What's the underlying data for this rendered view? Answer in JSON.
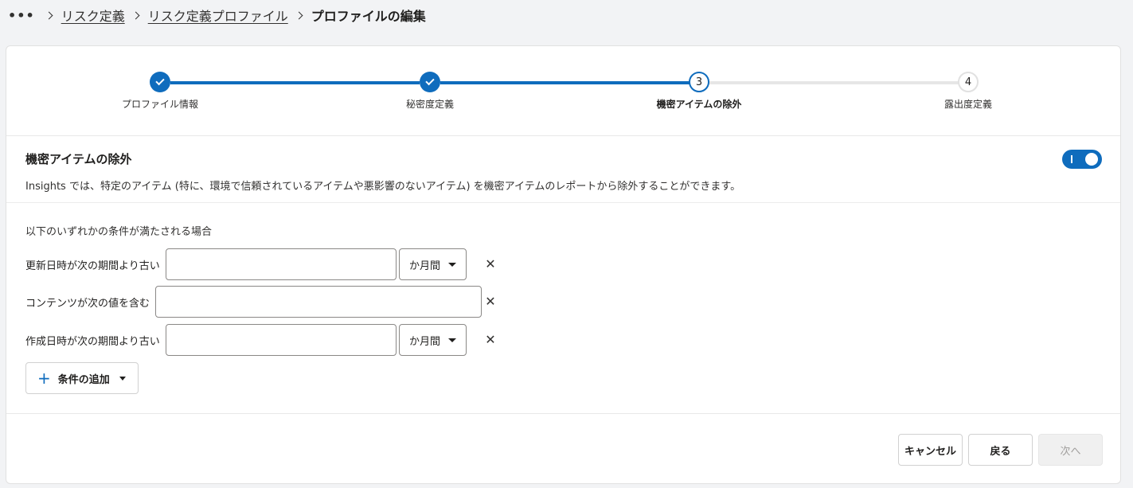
{
  "breadcrumb": {
    "more": "•••",
    "items": [
      "リスク定義",
      "リスク定義プロファイル"
    ],
    "current": "プロファイルの編集"
  },
  "stepper": {
    "steps": [
      {
        "label": "プロファイル情報",
        "state": "done",
        "number": "1"
      },
      {
        "label": "秘密度定義",
        "state": "done",
        "number": "2"
      },
      {
        "label": "機密アイテムの除外",
        "state": "current",
        "number": "3"
      },
      {
        "label": "露出度定義",
        "state": "todo",
        "number": "4"
      }
    ]
  },
  "section": {
    "title": "機密アイテムの除外",
    "description": "Insights では、特定のアイテム (特に、環境で信頼されているアイテムや悪影響のないアイテム) を機密アイテムのレポートから除外することができます。",
    "toggle_on": true,
    "toggle_glyph": "I"
  },
  "conditions": {
    "intro": "以下のいずれかの条件が満たされる場合",
    "rows": [
      {
        "label": "更新日時が次の期間より古い",
        "value": "",
        "unit": "か月間",
        "has_unit": true
      },
      {
        "label": "コンテンツが次の値を含む",
        "value": "",
        "has_unit": false
      },
      {
        "label": "作成日時が次の期間より古い",
        "value": "",
        "unit": "か月間",
        "has_unit": true
      }
    ],
    "remove_glyph": "✕",
    "add_label": "条件の追加",
    "add_icon": "+"
  },
  "footer": {
    "cancel": "キャンセル",
    "back": "戻る",
    "next": "次へ"
  },
  "colors": {
    "accent": "#0f6cbd",
    "background": "#f2f3f5"
  }
}
